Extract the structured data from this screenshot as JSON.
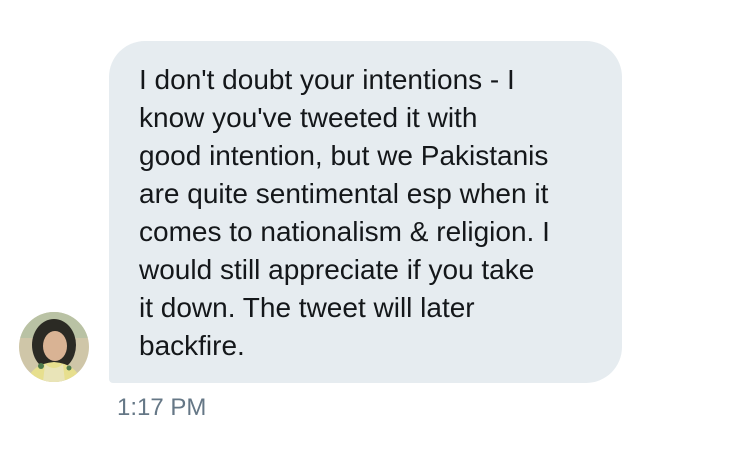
{
  "message": {
    "text": "I don't doubt your intentions - I\nknow you've tweeted it with\ngood intention, but we Pakistanis\nare quite sentimental esp when it\ncomes to nationalism & religion. I\nwould still appreciate if you take\nit down. The tweet will later\nbackfire.",
    "timestamp": "1:17 PM"
  },
  "sender": {
    "avatar": "profile-photo"
  },
  "colors": {
    "bubble_background": "#e6ecf0",
    "message_text": "#14171a",
    "timestamp_text": "#657786"
  }
}
